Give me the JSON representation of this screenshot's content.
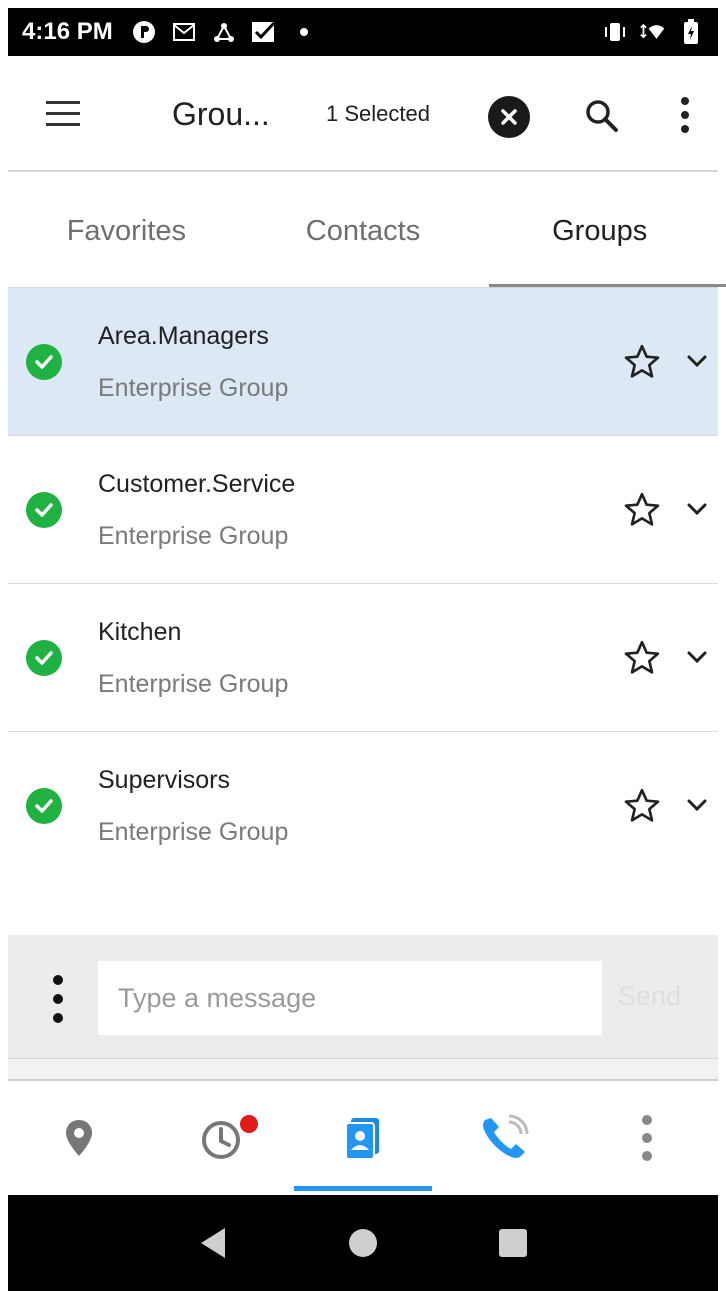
{
  "status_bar": {
    "time": "4:16 PM",
    "left_icons": [
      "notification-app-icon",
      "mail-icon",
      "network-icon",
      "task-check-icon",
      "dot-icon"
    ],
    "right_icons": [
      "vibrate-icon",
      "wifi-icon",
      "battery-icon"
    ]
  },
  "app_bar": {
    "title": "Grou...",
    "selected_text": "1 Selected"
  },
  "tabs": [
    {
      "label": "Favorites",
      "active": false
    },
    {
      "label": "Contacts",
      "active": false
    },
    {
      "label": "Groups",
      "active": true
    }
  ],
  "groups": [
    {
      "name": "Area.Managers",
      "type": "Enterprise Group",
      "selected": true
    },
    {
      "name": "Customer.Service",
      "type": "Enterprise Group",
      "selected": false
    },
    {
      "name": "Kitchen",
      "type": "Enterprise Group",
      "selected": false
    },
    {
      "name": "Supervisors",
      "type": "Enterprise Group",
      "selected": false
    }
  ],
  "composer": {
    "placeholder": "Type a message",
    "send_label": "Send"
  },
  "bottom_nav": [
    {
      "name": "location",
      "icon": "location-pin-icon",
      "active": false
    },
    {
      "name": "history",
      "icon": "clock-icon",
      "active": false,
      "badge": true
    },
    {
      "name": "contacts",
      "icon": "contacts-book-icon",
      "active": true
    },
    {
      "name": "calls",
      "icon": "phone-wifi-icon",
      "active": false
    },
    {
      "name": "more",
      "icon": "more-vertical-icon",
      "active": false
    }
  ],
  "colors": {
    "accent": "#2196f3",
    "selected_row": "#dce9f5",
    "check_green": "#1fb141",
    "badge_red": "#e01b1b"
  }
}
